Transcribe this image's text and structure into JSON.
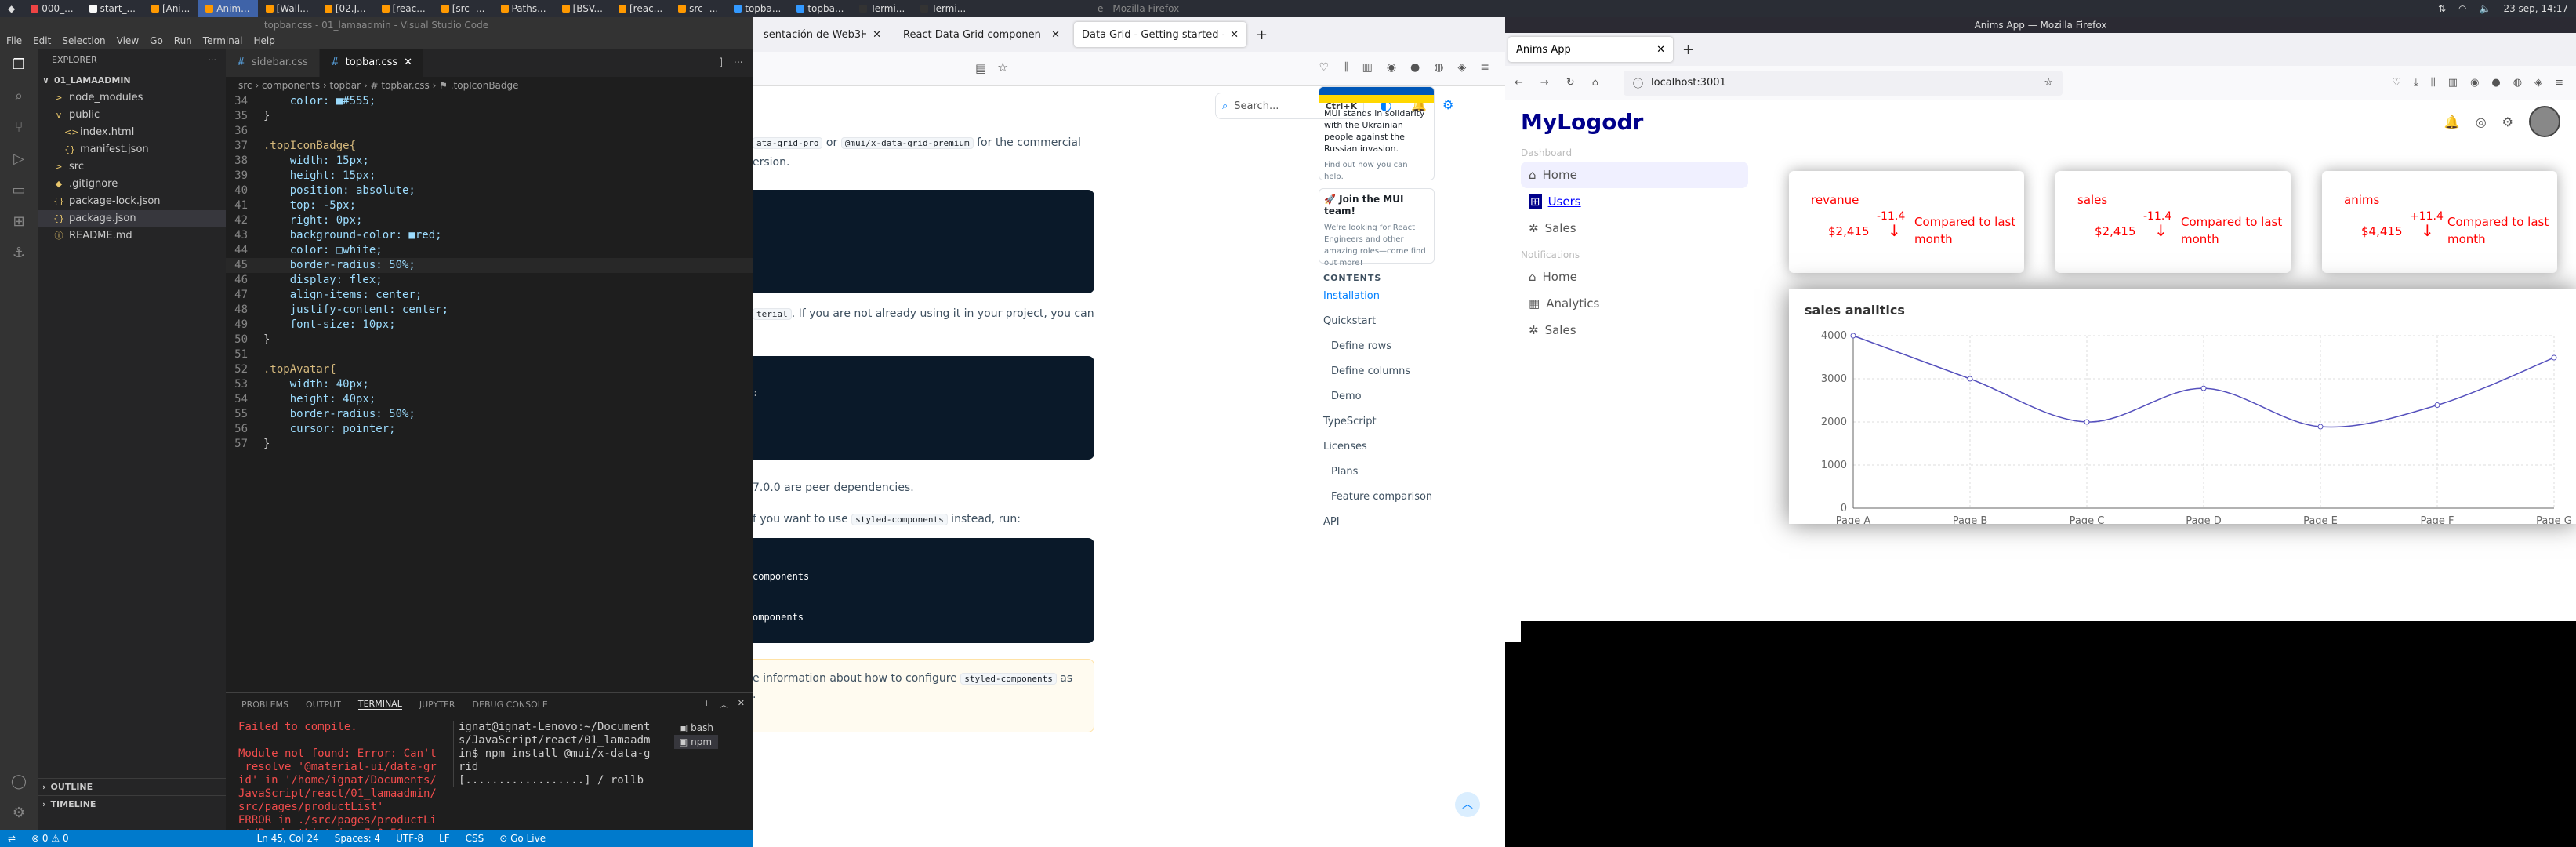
{
  "taskbar": {
    "items": [
      "000_...",
      "start_...",
      "[Ani...",
      "Anim...",
      "[Wall...",
      "[02.J...",
      "[reac...",
      "[src -...",
      "Paths...",
      "[BSV...",
      "[reac...",
      "src -...",
      "topba...",
      "topba...",
      "Termi...",
      "Termi..."
    ],
    "clock": "23 sep, 14:17"
  },
  "vscode": {
    "title": "topbar.css - 01_lamaadmin - Visual Studio Code",
    "menu": [
      "File",
      "Edit",
      "Selection",
      "View",
      "Go",
      "Run",
      "Terminal",
      "Help"
    ],
    "explorer_title": "EXPLORER",
    "project": "01_LAMAADMIN",
    "tree": [
      {
        "label": "node_modules",
        "indent": 1,
        "icon": ">"
      },
      {
        "label": "public",
        "indent": 1,
        "icon": "v"
      },
      {
        "label": "index.html",
        "indent": 2,
        "icon": "<>"
      },
      {
        "label": "manifest.json",
        "indent": 2,
        "icon": "{}"
      },
      {
        "label": "src",
        "indent": 1,
        "icon": ">"
      },
      {
        "label": ".gitignore",
        "indent": 1,
        "icon": "◆"
      },
      {
        "label": "package-lock.json",
        "indent": 1,
        "icon": "{}"
      },
      {
        "label": "package.json",
        "indent": 1,
        "icon": "{}"
      },
      {
        "label": "README.md",
        "indent": 1,
        "icon": "ⓘ"
      }
    ],
    "tabs": [
      {
        "label": "sidebar.css",
        "active": false
      },
      {
        "label": "topbar.css",
        "active": true
      }
    ],
    "breadcrumb": "src › components › topbar › # topbar.css › ⚑ .topIconBadge",
    "code_lines": [
      {
        "n": "34",
        "t": "    color: ■#555;",
        "cls": "prop"
      },
      {
        "n": "35",
        "t": "}",
        "cls": "pun"
      },
      {
        "n": "36",
        "t": "",
        "cls": "pun"
      },
      {
        "n": "37",
        "t": ".topIconBadge{",
        "cls": "sel-c"
      },
      {
        "n": "38",
        "t": "    width: 15px;",
        "cls": "prop"
      },
      {
        "n": "39",
        "t": "    height: 15px;",
        "cls": "prop"
      },
      {
        "n": "40",
        "t": "    position: absolute;",
        "cls": "prop"
      },
      {
        "n": "41",
        "t": "    top: -5px;",
        "cls": "prop"
      },
      {
        "n": "42",
        "t": "    right: 0px;",
        "cls": "prop"
      },
      {
        "n": "43",
        "t": "    background-color: ■red;",
        "cls": "prop"
      },
      {
        "n": "44",
        "t": "    color: □white;",
        "cls": "prop"
      },
      {
        "n": "45",
        "t": "    border-radius: 50%;",
        "cls": "prop"
      },
      {
        "n": "46",
        "t": "    display: flex;",
        "cls": "prop"
      },
      {
        "n": "47",
        "t": "    align-items: center;",
        "cls": "prop"
      },
      {
        "n": "48",
        "t": "    justify-content: center;",
        "cls": "prop"
      },
      {
        "n": "49",
        "t": "    font-size: 10px;",
        "cls": "prop"
      },
      {
        "n": "50",
        "t": "}",
        "cls": "pun"
      },
      {
        "n": "51",
        "t": "",
        "cls": "pun"
      },
      {
        "n": "52",
        "t": ".topAvatar{",
        "cls": "sel-c"
      },
      {
        "n": "53",
        "t": "    width: 40px;",
        "cls": "prop"
      },
      {
        "n": "54",
        "t": "    height: 40px;",
        "cls": "prop"
      },
      {
        "n": "55",
        "t": "    border-radius: 50%;",
        "cls": "prop"
      },
      {
        "n": "56",
        "t": "    cursor: pointer;",
        "cls": "prop"
      },
      {
        "n": "57",
        "t": "}",
        "cls": "pun"
      }
    ],
    "current_line": "45",
    "panel_tabs": [
      "PROBLEMS",
      "OUTPUT",
      "TERMINAL",
      "JUPYTER",
      "DEBUG CONSOLE"
    ],
    "panel_active": "TERMINAL",
    "terminal_left": "Failed to compile.\n\nModule not found: Error: Can't\n resolve '@material-ui/data-gr\nid' in '/home/ignat/Documents/\nJavaScript/react/01_lamaadmin/\nsrc/pages/productList'\nERROR in ./src/pages/productLi\nst/ProductList.jsx 7:0-50",
    "terminal_right": "ignat@ignat-Lenovo:~/Document\ns/JavaScript/react/01_lamaadm\nin$ npm install @mui/x-data-g\nrid\n[..................] / rollb",
    "terminal_list": [
      "bash",
      "npm"
    ],
    "outline": "OUTLINE",
    "timeline": "TIMELINE",
    "status": {
      "errors": "⊗ 0 ⚠ 0",
      "position": "Ln 45, Col 24",
      "spaces": "Spaces: 4",
      "encoding": "UTF-8",
      "eol": "LF",
      "lang": "CSS",
      "golive": "⊙ Go Live"
    }
  },
  "ff1": {
    "tabs": [
      "sentación de Web3Hub c",
      "React Data Grid componen",
      "Data Grid - Getting started - !"
    ],
    "title_partial": "e - Mozilla Firefox",
    "search_placeholder": "Search...",
    "search_shortcut": "Ctrl+K",
    "badge": "3",
    "p1a": "ata-grid-pro",
    "p1b": " or ",
    "p1c": "@mui/x-data-grid-premium",
    "p1d": " for the commercial",
    "p1e": "ersion.",
    "p2a": "terial",
    "p2b": ". If you are not already using it in your project, you can",
    "p3": "7.0.0 are peer dependencies.",
    "p4a": "f you want to use ",
    "p4b": "styled-components",
    "p4c": " instead, run:",
    "code3a": "components",
    "code3b": "omponents",
    "note_a": "e information about how to configure ",
    "note_b": "styled-components",
    "note_c": " as",
    "note_d": ".",
    "ukraine": "MUI stands in solidarity with the Ukrainian people against the Russian invasion.",
    "ukraine_link": "Find out how you can help.",
    "join_title": "🚀 Join the MUI team!",
    "join_text": "We're looking for React Engineers and other amazing roles—come find out more!",
    "contents_title": "CONTENTS",
    "toc": [
      {
        "label": "Installation",
        "indent": 0,
        "active": true
      },
      {
        "label": "Quickstart",
        "indent": 0,
        "active": false
      },
      {
        "label": "Define rows",
        "indent": 1,
        "active": false
      },
      {
        "label": "Define columns",
        "indent": 1,
        "active": false
      },
      {
        "label": "Demo",
        "indent": 1,
        "active": false
      },
      {
        "label": "TypeScript",
        "indent": 0,
        "active": false
      },
      {
        "label": "Licenses",
        "indent": 0,
        "active": false
      },
      {
        "label": "Plans",
        "indent": 1,
        "active": false
      },
      {
        "label": "Feature comparison",
        "indent": 1,
        "active": false
      },
      {
        "label": "API",
        "indent": 0,
        "active": false
      }
    ]
  },
  "ff2": {
    "window_title": "Anims App — Mozilla Firefox",
    "tab": "Anims App",
    "url": "localhost:3001",
    "logo": "MyLogodr",
    "sidebar": {
      "dashboard_title": "Dashboard",
      "dashboard_items": [
        {
          "label": "Home",
          "icon": "home-icon",
          "selected": true,
          "link": false
        },
        {
          "label": "Users",
          "icon": "users-icon",
          "selected": false,
          "link": true
        },
        {
          "label": "Sales",
          "icon": "sales-icon",
          "selected": false,
          "link": false
        }
      ],
      "notifications_title": "Notifications",
      "notification_items": [
        {
          "label": "Home",
          "icon": "home-icon"
        },
        {
          "label": "Analytics",
          "icon": "analytics-icon"
        },
        {
          "label": "Sales",
          "icon": "sales-icon"
        }
      ]
    },
    "widgets": [
      {
        "title": "revanue",
        "money": "$2,415",
        "rate": "-11.4",
        "arrow": "down",
        "sub": "Compared to last month"
      },
      {
        "title": "sales",
        "money": "$2,415",
        "rate": "-11.4",
        "arrow": "down",
        "sub": "Compared to last month"
      },
      {
        "title": "anims",
        "money": "$4,415",
        "rate": "+11.4",
        "arrow": "down",
        "sub": "Compared to last month"
      }
    ],
    "chart_title": "sales analitics"
  },
  "chart_data": {
    "type": "line",
    "title": "sales analitics",
    "categories": [
      "Page A",
      "Page B",
      "Page C",
      "Page D",
      "Page E",
      "Page F",
      "Page G"
    ],
    "series": [
      {
        "values": [
          4000,
          3000,
          2000,
          2780,
          1890,
          2390,
          3490
        ]
      }
    ],
    "yticks": [
      0,
      1000,
      2000,
      3000,
      4000
    ],
    "ylim": [
      0,
      4000
    ],
    "grid": true,
    "line_color": "#5550bd"
  }
}
